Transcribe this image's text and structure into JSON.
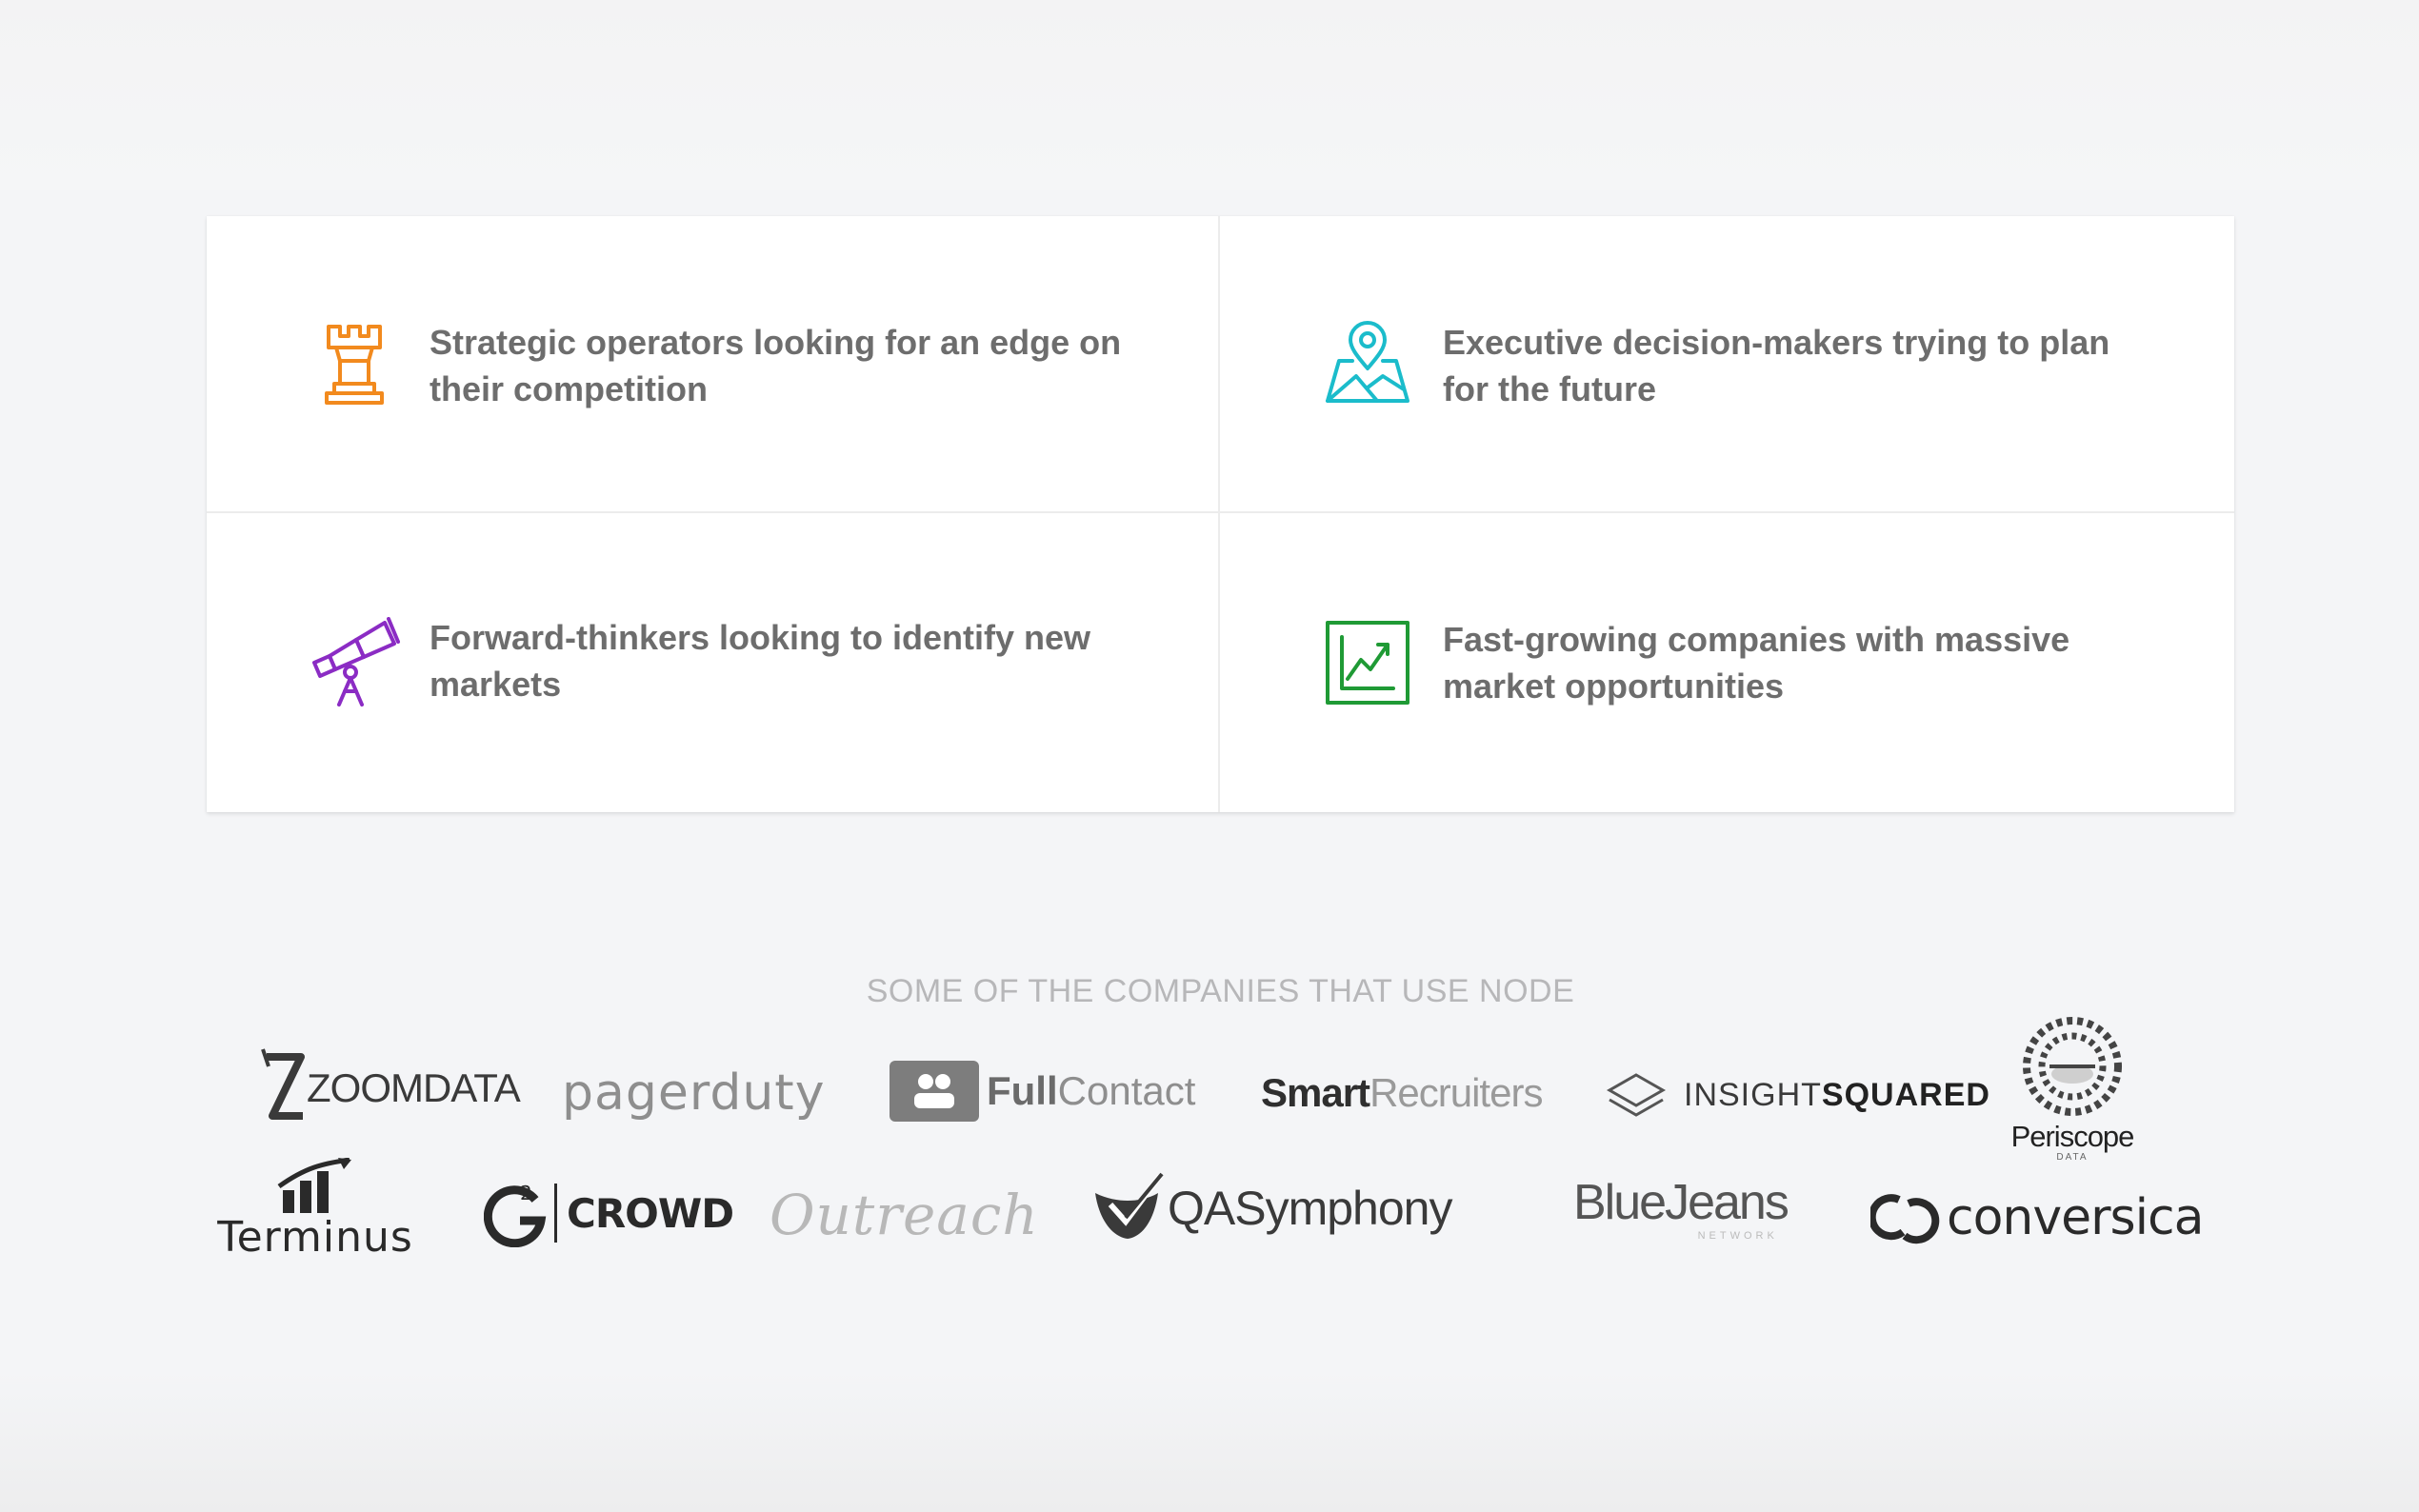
{
  "audience": [
    {
      "text": "Strategic operators looking for an edge on their competition",
      "icon": "chess-rook-icon",
      "color": "#f28a1e"
    },
    {
      "text": "Executive decision-makers trying to plan for the future",
      "icon": "map-pin-icon",
      "color": "#1bbccb"
    },
    {
      "text": "Forward-thinkers looking to identify new markets",
      "icon": "telescope-icon",
      "color": "#8b2cc4"
    },
    {
      "text": "Fast-growing companies with massive market opportunities",
      "icon": "growth-chart-icon",
      "color": "#1f9a35"
    }
  ],
  "companies": {
    "title": "SOME OF THE COMPANIES THAT USE NODE",
    "logos": {
      "zoomdata": "ZOOMDATA",
      "pagerduty": "pagerduty",
      "fullcontact_a": "Full",
      "fullcontact_b": "Contact",
      "smartrecruiters_a": "Smart",
      "smartrecruiters_b": "Recruiters",
      "insightsquared_a": "INSIGHT",
      "insightsquared_b": "SQUARED",
      "periscope": "Periscope",
      "periscope_sub": "DATA",
      "terminus": "Terminus",
      "g2crowd": "CROWD",
      "outreach": "Outreach",
      "qasymphony": "QASymphony",
      "bluejeans": "BlueJeans",
      "bluejeans_sub": "NETWORK",
      "conversica": "conversica"
    }
  }
}
